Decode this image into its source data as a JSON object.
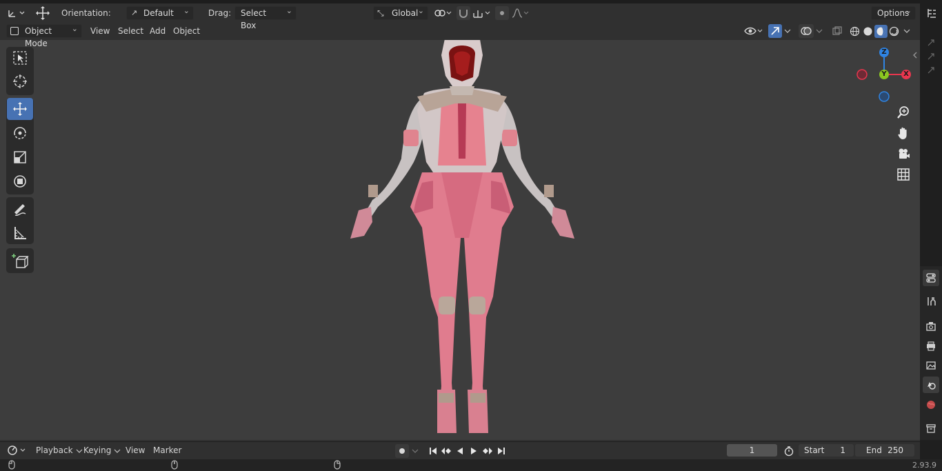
{
  "header": {
    "orientation_label": "Orientation:",
    "orientation_value": "Default",
    "drag_label": "Drag:",
    "drag_value": "Select Box",
    "transform_space": "Global",
    "options_label": "Options"
  },
  "viewport_header": {
    "mode": "Object Mode",
    "menus": [
      "View",
      "Select",
      "Add",
      "Object"
    ]
  },
  "gizmo": {
    "z_label": "Z",
    "y_label": "Y",
    "x_label": "X",
    "colors": {
      "x": "#e8364e",
      "y": "#8bc720",
      "z": "#2f84e3"
    }
  },
  "left_tools": [
    {
      "name": "select-box-icon"
    },
    {
      "name": "cursor-icon"
    },
    {
      "name": "move-icon",
      "active": true
    },
    {
      "name": "rotate-icon"
    },
    {
      "name": "scale-icon"
    },
    {
      "name": "transform-icon"
    },
    {
      "name": "annotate-icon"
    },
    {
      "name": "measure-icon"
    },
    {
      "name": "add-cube-icon"
    }
  ],
  "timeline": {
    "menus": [
      "Playback",
      "Keying",
      "View",
      "Marker"
    ],
    "current_frame": "1",
    "start_label": "Start",
    "start_value": "1",
    "end_label": "End",
    "end_value": "250"
  },
  "status": {
    "version": "2.93.9"
  },
  "colors": {
    "accent": "#4772b3",
    "viewport_bg": "#3d3d3d",
    "suit_pink": "#e07c8e",
    "suit_skin": "#c9c2c2"
  }
}
